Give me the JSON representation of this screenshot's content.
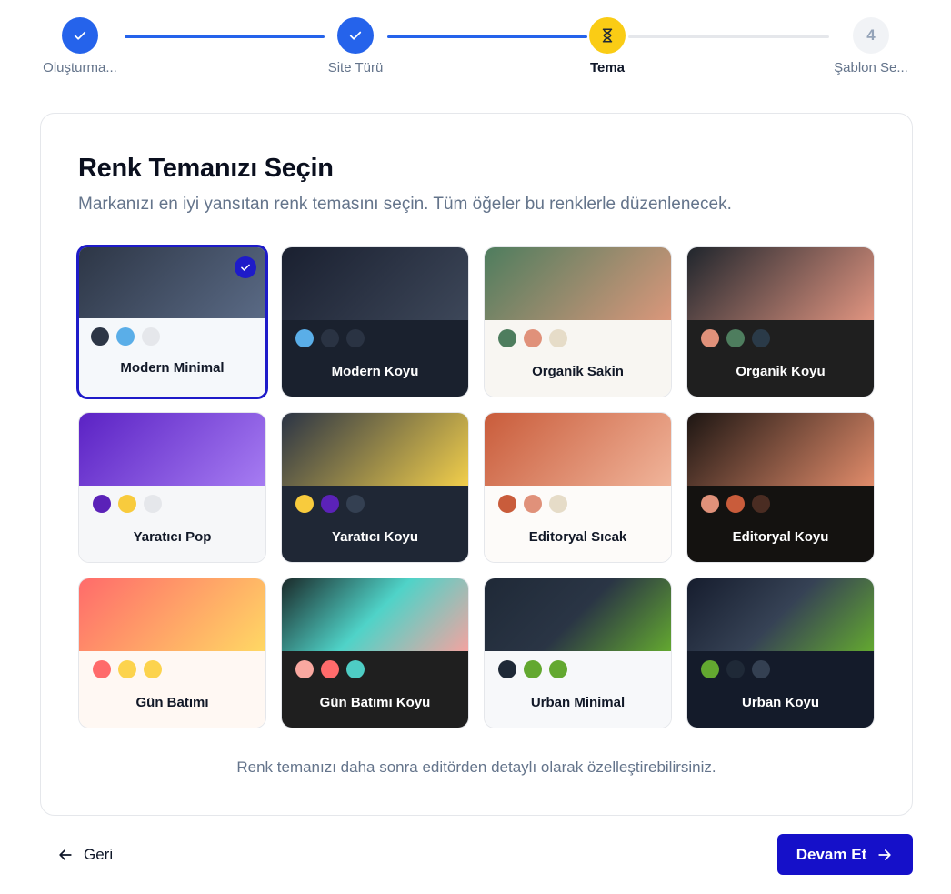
{
  "stepper": {
    "steps": [
      {
        "label": "Oluşturma...",
        "state": "done"
      },
      {
        "label": "Site Türü",
        "state": "done"
      },
      {
        "label": "Tema",
        "state": "current"
      },
      {
        "label": "Şablon Se...",
        "state": "todo",
        "number": "4"
      }
    ],
    "colors": {
      "done": "#2563eb",
      "current": "#facc15",
      "todo": "#f1f3f6",
      "line_done": "#2563eb",
      "line_todo": "#e5e7eb"
    }
  },
  "card": {
    "title": "Renk Temanızı Seçin",
    "subtitle": "Markanızı en iyi yansıtan renk temasını seçin. Tüm öğeler bu renklerle düzenlenecek.",
    "hint": "Renk temanızı daha sonra editörden detaylı olarak özelleştirebilirsiniz."
  },
  "themes": [
    {
      "name": "Modern Minimal",
      "selected": true,
      "gradient": [
        "#2d3646",
        "#5a6a85"
      ],
      "body": "#f5f8fb",
      "text": "#111827",
      "dots": [
        "#2d3646",
        "#5aaee8",
        "#e5e7eb"
      ]
    },
    {
      "name": "Modern Koyu",
      "selected": false,
      "gradient": [
        "#1a2030",
        "#3d4759"
      ],
      "body": "#1a212e",
      "text": "#ffffff",
      "dots": [
        "#5aaee8",
        "#2a3343",
        "#2a3343"
      ]
    },
    {
      "name": "Organik Sakin",
      "selected": false,
      "gradient": [
        "#4e7d5e",
        "#da977b"
      ],
      "body": "#f8f6f2",
      "text": "#111827",
      "dots": [
        "#4e7d5e",
        "#e0917a",
        "#e6dcc8"
      ]
    },
    {
      "name": "Organik Koyu",
      "selected": false,
      "gradient": [
        "#20262d",
        "#e09480"
      ],
      "body": "#1f1f1f",
      "text": "#ffffff",
      "dots": [
        "#e0917a",
        "#4e7d5e",
        "#2a3a48"
      ]
    },
    {
      "name": "Yaratıcı Pop",
      "selected": false,
      "gradient": [
        "#5b22c4",
        "#a67cf2"
      ],
      "body": "#f6f7f9",
      "text": "#111827",
      "dots": [
        "#5b22b8",
        "#f8cb3d",
        "#e5e7eb"
      ]
    },
    {
      "name": "Yaratıcı Koyu",
      "selected": false,
      "gradient": [
        "#2b3445",
        "#f1ce4b"
      ],
      "body": "#1f2735",
      "text": "#ffffff",
      "dots": [
        "#f8cb3d",
        "#5b22b8",
        "#344052"
      ]
    },
    {
      "name": "Editoryal Sıcak",
      "selected": false,
      "gradient": [
        "#c95c3b",
        "#f0b49a"
      ],
      "body": "#fdfbf9",
      "text": "#111827",
      "dots": [
        "#c95c3b",
        "#e0917a",
        "#e6dcc8"
      ]
    },
    {
      "name": "Editoryal Koyu",
      "selected": false,
      "gradient": [
        "#1d1613",
        "#e08b6a"
      ],
      "body": "#141210",
      "text": "#ffffff",
      "dots": [
        "#e0917a",
        "#c95c3b",
        "#4a2c22"
      ]
    },
    {
      "name": "Gün Batımı",
      "selected": false,
      "gradient": [
        "#ff6b6b",
        "#ffd864"
      ],
      "body": "#fff8f3",
      "text": "#111827",
      "dots": [
        "#ff6b6b",
        "#fcd34d",
        "#fcd34d"
      ]
    },
    {
      "name": "Gün Batımı Koyu",
      "selected": false,
      "gradient": [
        "#1b2a2a",
        "#4fd3c8",
        "#f3a3a0"
      ],
      "body": "#1f1f1f",
      "text": "#ffffff",
      "dots": [
        "#f9a8a0",
        "#ff6b6b",
        "#4ecdc4"
      ]
    },
    {
      "name": "Urban Minimal",
      "selected": false,
      "gradient": [
        "#1f2937",
        "#2a3545",
        "#63a830"
      ],
      "body": "#f7f8fa",
      "text": "#111827",
      "dots": [
        "#1f2937",
        "#63a830",
        "#63a830"
      ]
    },
    {
      "name": "Urban Koyu",
      "selected": false,
      "gradient": [
        "#161d2e",
        "#364255",
        "#63a830"
      ],
      "body": "#141b2a",
      "text": "#ffffff",
      "dots": [
        "#63a830",
        "#1f2937",
        "#344052"
      ]
    }
  ],
  "footer": {
    "back_label": "Geri",
    "next_label": "Devam Et",
    "accent": "#1510c9"
  },
  "icons": {
    "check": "check-icon",
    "current_step": "hourglass-icon",
    "back": "arrow-left-icon",
    "next": "arrow-right-icon"
  }
}
